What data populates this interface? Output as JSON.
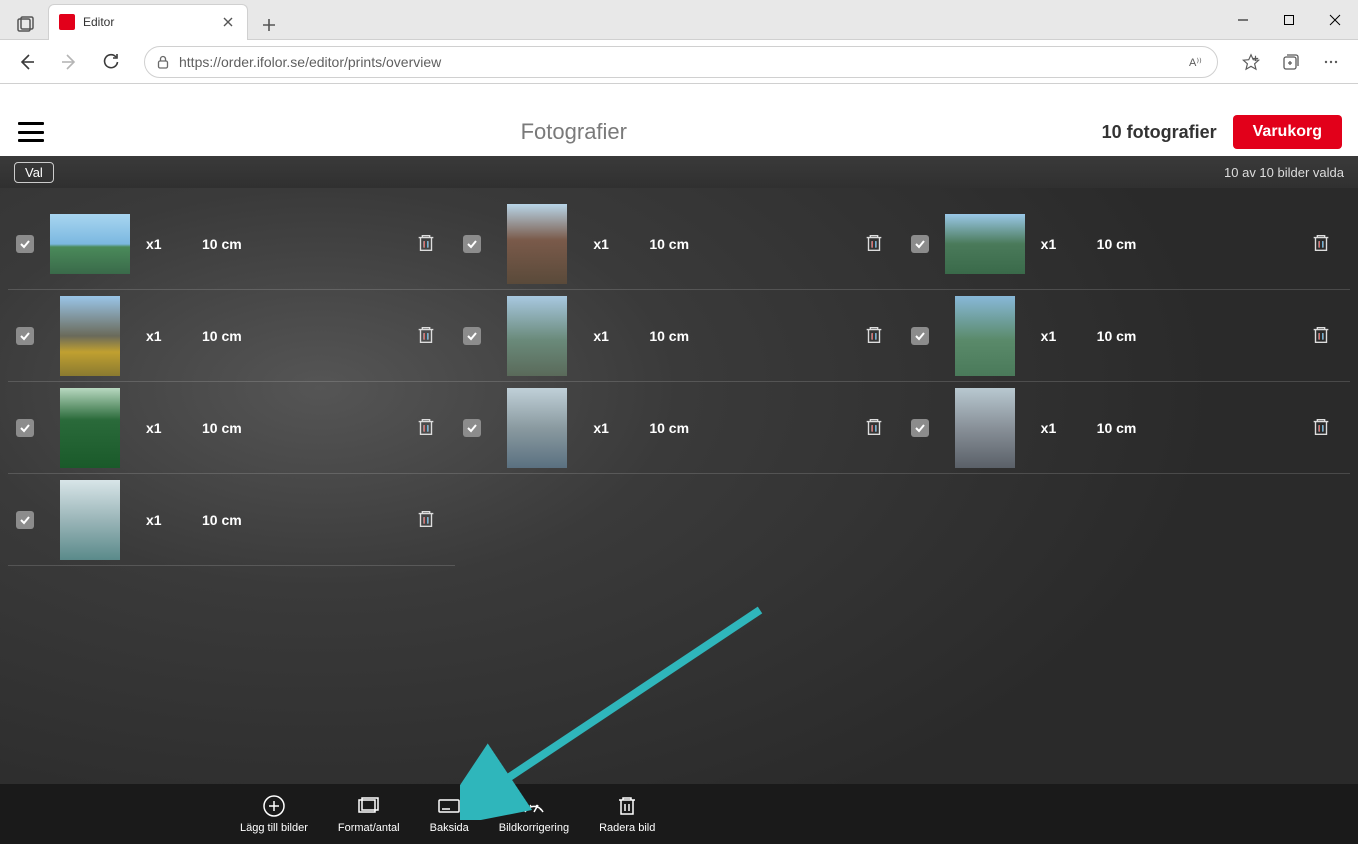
{
  "browser": {
    "tab_title": "Editor",
    "url": "https://order.ifolor.se/editor/prints/overview"
  },
  "header": {
    "page_title": "Fotografier",
    "photo_count_text": "10 fotografier",
    "cart_label": "Varukorg"
  },
  "selection_bar": {
    "button_label": "Val",
    "status_text": "10 av 10 bilder valda"
  },
  "photos": {
    "quantity_label": "x1",
    "size_label": "10 cm",
    "columns": [
      [
        {
          "orient": "land"
        },
        {
          "orient": "port"
        },
        {
          "orient": "port"
        },
        {
          "orient": "port"
        }
      ],
      [
        {
          "orient": "port"
        },
        {
          "orient": "port"
        },
        {
          "orient": "port"
        }
      ],
      [
        {
          "orient": "land"
        },
        {
          "orient": "port"
        },
        {
          "orient": "port"
        }
      ]
    ]
  },
  "toolbar": {
    "items": [
      {
        "key": "add",
        "label": "Lägg till bilder"
      },
      {
        "key": "format",
        "label": "Format/antal"
      },
      {
        "key": "backside",
        "label": "Baksida"
      },
      {
        "key": "correct",
        "label": "Bildkorrigering"
      },
      {
        "key": "delete",
        "label": "Radera bild"
      }
    ]
  }
}
